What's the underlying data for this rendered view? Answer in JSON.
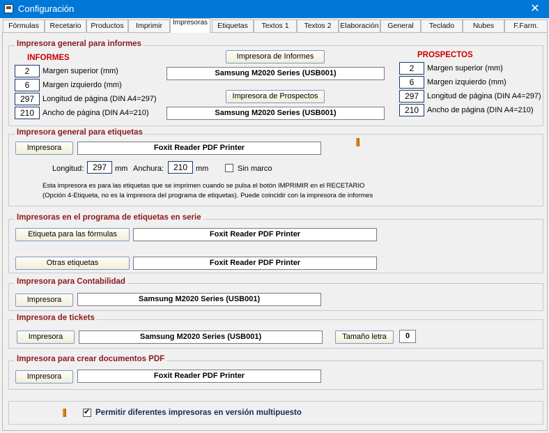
{
  "window": {
    "title": "Configuración",
    "close_symbol": "✕"
  },
  "tabs": [
    {
      "label": "Fórmulas"
    },
    {
      "label": "Recetario"
    },
    {
      "label": "Productos"
    },
    {
      "label": "Imprimir"
    },
    {
      "label": "Impresoras"
    },
    {
      "label": "Etiquetas"
    },
    {
      "label": "Textos 1"
    },
    {
      "label": "Textos 2"
    },
    {
      "label": "Elaboración"
    },
    {
      "label": "General"
    },
    {
      "label": "Teclado"
    },
    {
      "label": "Nubes"
    },
    {
      "label": "F.Farm."
    }
  ],
  "informes": {
    "group_title": "Impresora general para informes",
    "left_heading": "INFORMES",
    "right_heading": "PROSPECTOS",
    "informes_button": "Impresora de Informes",
    "informes_printer": "Samsung M2020 Series (USB001)",
    "prospectos_button": "Impresora de Prospectos",
    "prospectos_printer": "Samsung M2020 Series (USB001)",
    "left_fields": [
      {
        "value": "2",
        "label": "Margen superior (mm)"
      },
      {
        "value": "6",
        "label": "Margen izquierdo (mm)"
      },
      {
        "value": "297",
        "label": "Longitud de página (DIN A4=297)"
      },
      {
        "value": "210",
        "label": "Ancho de página (DIN A4=210)"
      }
    ],
    "right_fields": [
      {
        "value": "2",
        "label": "Margen superior (mm)"
      },
      {
        "value": "6",
        "label": "Margen izquierdo (mm)"
      },
      {
        "value": "297",
        "label": "Longitud de página (DIN A4=297)"
      },
      {
        "value": "210",
        "label": "Ancho de página (DIN A4=210)"
      }
    ]
  },
  "etiquetas": {
    "group_title": "Impresora general para etiquetas",
    "button": "Impresora",
    "printer": "Foxit Reader PDF Printer",
    "longitud_label": "Longitud:",
    "longitud_value": "297",
    "anchura_label": "Anchura:",
    "anchura_value": "210",
    "unit": "mm",
    "sin_marco_label": "Sin marco",
    "note_line1": "Esta impresora es para las etiquetas que se imprimen cuando se pulsa el botón IMPRIMIR en el RECETARIO",
    "note_line2": "(Opción 4-Etiqueta, no es la impresora del programa de etiquetas). Puede coincidir con la impresora de informes"
  },
  "serie": {
    "group_title": "Impresoras en el programa de etiquetas en serie",
    "formulas_button": "Etiqueta para las fórmulas",
    "formulas_printer": "Foxit Reader PDF Printer",
    "otras_button": "Otras etiquetas",
    "otras_printer": "Foxit Reader PDF Printer"
  },
  "contabilidad": {
    "group_title": "Impresora para Contabilidad",
    "button": "Impresora",
    "printer": "Samsung M2020 Series (USB001)"
  },
  "tickets": {
    "group_title": "Impresora de tickets",
    "button": "Impresora",
    "printer": "Samsung M2020 Series (USB001)",
    "size_button": "Tamaño letra",
    "size_value": "0"
  },
  "pdf": {
    "group_title": "Impresora para crear documentos PDF",
    "button": "Impresora",
    "printer": "Foxit Reader PDF Printer"
  },
  "multipuesto": {
    "label": "Permitir diferentes impresoras en versión multipuesto",
    "checked": true
  },
  "colors": {
    "titlebar": "#0078d7",
    "group_title": "#8b1a1a",
    "heading_red": "#cc0000",
    "marker": "#e88a1a"
  }
}
